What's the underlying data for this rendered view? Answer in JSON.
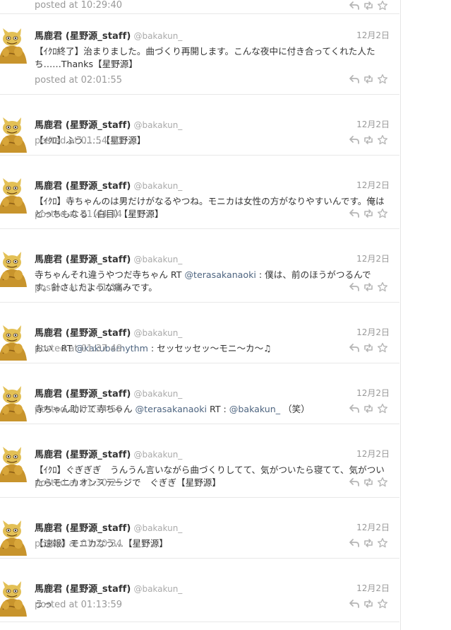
{
  "icons": {
    "reply": "reply-icon",
    "retweet": "retweet-icon",
    "favorite": "star-icon",
    "avatar": "golden-mascot-avatar"
  },
  "colors": {
    "link": "#4e6580",
    "meta": "#999999",
    "name": "#333333"
  },
  "top_partial": {
    "posted": "posted at 10:29:40"
  },
  "tweets": [
    {
      "name": "馬鹿君 (星野源_staff)",
      "handle": "@bakakun_",
      "date": "12月2日",
      "text": [
        "【ｲｸﾛ終了】治まりました。曲づくり再開します。こんな夜中に付き合ってくれた人たち……Thanks【星野源】"
      ],
      "posted": "posted at 02:01:55"
    },
    {
      "name": "馬鹿君 (星野源_staff)",
      "handle": "@bakakun_",
      "date": "12月2日",
      "text": [
        "【ｲｸﾛ】ふう……【星野源】"
      ],
      "posted": "posted at 01:54:40"
    },
    {
      "name": "馬鹿君 (星野源_staff)",
      "handle": "@bakakun_",
      "date": "12月2日",
      "text": [
        "【ｲｸﾛ】寺ちゃんのは男だけがなるやつね。モニカは女性の方がなりやすいんです。俺はどっちもなる（白目）【星野源】"
      ],
      "posted": "posted at 01:44:44"
    },
    {
      "name": "馬鹿君 (星野源_staff)",
      "handle": "@bakakun_",
      "date": "12月2日",
      "text": [
        "寺ちゃんそれ違うやつだ寺ちゃん RT ",
        "@terasakanaoki",
        " : 僕は、前のほうがつるんです。針さしたような痛みです。"
      ],
      "posted": "posted at 01:41:19"
    },
    {
      "name": "馬鹿君 (星野源_staff)",
      "handle": "@bakakun_",
      "date": "12月2日",
      "text": [
        "おい　RT ",
        "@kakubarhythm",
        " : セッセッセッ〜モニ〜カ〜♫"
      ],
      "posted": "posted at 01:37:49"
    },
    {
      "name": "馬鹿君 (星野源_staff)",
      "handle": "@bakakun_",
      "date": "12月2日",
      "text": [
        "寺ちゃん助けて寺ちゃん ",
        "@terasakanaoki",
        " RT : ",
        "@bakakun_",
        " （笑）"
      ],
      "posted": "posted at 01:34:58"
    },
    {
      "name": "馬鹿君 (星野源_staff)",
      "handle": "@bakakun_",
      "date": "12月2日",
      "text": [
        "【ｲｸﾛ】ぐぎぎぎ　うんうん言いながら曲づくりしてて、気がついたら寝てて、気がついたらモニカオンステージで　ぐぎぎ【星野源】"
      ],
      "posted": "posted at 01:30:25"
    },
    {
      "name": "馬鹿君 (星野源_staff)",
      "handle": "@bakakun_",
      "date": "12月2日",
      "text": [
        "【速報】モニカなう…【星野源】"
      ],
      "posted": "posted at 01:20:34"
    },
    {
      "name": "馬鹿君 (星野源_staff)",
      "handle": "@bakakun_",
      "date": "12月2日",
      "text": [
        "うっ"
      ],
      "posted": "posted at 01:13:59"
    }
  ]
}
